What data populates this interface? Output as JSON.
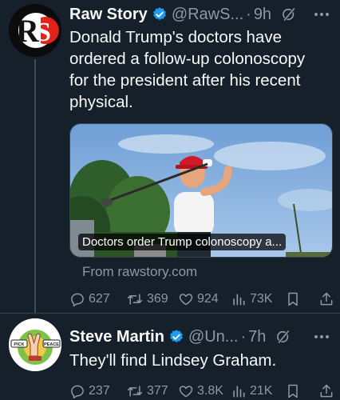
{
  "tweets": [
    {
      "author": {
        "name": "Raw Story",
        "handle": "@RawS...",
        "logo_text": "RS"
      },
      "time": "9h",
      "text": "Donald Trump's doctors have ordered a follow-up colonoscopy for the president after his recent physical.",
      "card": {
        "caption": "Doctors order Trump colonoscopy a...",
        "source": "From rawstory.com"
      },
      "actions": {
        "replies": "627",
        "reposts": "369",
        "likes": "924",
        "views": "73K"
      }
    },
    {
      "author": {
        "name": "Steve Martin",
        "handle": "@Un..."
      },
      "time": "7h",
      "text": "They'll find Lindsey Graham.",
      "avatar_labels": {
        "left": "PICK",
        "right": "PEACE"
      },
      "actions": {
        "replies": "237",
        "reposts": "377",
        "likes": "3.8K",
        "views": "21K"
      }
    }
  ],
  "ui": {
    "separator": "·",
    "icons": {
      "verified": "verified-badge-icon",
      "grok": "grok-icon",
      "more": "more-icon",
      "reply": "reply-icon",
      "repost": "repost-icon",
      "like": "like-icon",
      "views": "views-icon",
      "bookmark": "bookmark-icon",
      "share": "share-icon"
    }
  },
  "colors": {
    "background": "#15202b",
    "text_primary": "#f7f9f9",
    "text_secondary": "#8b98a5",
    "verified": "#1d9bf0",
    "brand_red": "#e2231a",
    "divider": "#38444d"
  }
}
